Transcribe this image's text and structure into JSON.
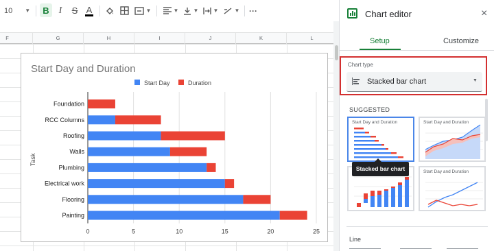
{
  "toolbar": {
    "font_size": "10",
    "bold": "B",
    "italic": "I",
    "strike": "S",
    "text_color": "A",
    "more": "···",
    "accent_green": "#188038",
    "icons": [
      "paint-fill-icon",
      "borders-icon",
      "merge-cells-icon",
      "align-horizontal-icon",
      "align-vertical-icon",
      "text-wrap-icon",
      "text-rotation-icon",
      "more-icon"
    ]
  },
  "sheet": {
    "columns": [
      "F",
      "G",
      "H",
      "I",
      "J",
      "K",
      "L"
    ]
  },
  "chart_data": {
    "type": "bar",
    "orientation": "horizontal",
    "stacked": true,
    "title": "Start Day and Duration",
    "ylabel": "Task",
    "xlabel": "",
    "categories": [
      "Foundation",
      "RCC Columns",
      "Roofing",
      "Walls",
      "Plumbing",
      "Electrical work",
      "Flooring",
      "Painting"
    ],
    "series": [
      {
        "name": "Start Day",
        "color": "#4285f4",
        "values": [
          0,
          3,
          8,
          9,
          13,
          15,
          17,
          21
        ]
      },
      {
        "name": "Duration",
        "color": "#ea4335",
        "values": [
          3,
          5,
          7,
          4,
          1,
          1,
          3,
          3
        ]
      }
    ],
    "xlim": [
      0,
      25
    ],
    "xticks": [
      "0",
      "5",
      "10",
      "15",
      "20",
      "25"
    ],
    "grid": true,
    "legend_position": "top"
  },
  "editor": {
    "title": "Chart editor",
    "close_icon": "×",
    "tabs": [
      {
        "label": "Setup",
        "active": true
      },
      {
        "label": "Customize",
        "active": false
      }
    ],
    "chart_type_label": "Chart type",
    "chart_type_value": "Stacked bar chart",
    "caret": "▼",
    "suggested_label": "SUGGESTED",
    "suggestions": [
      {
        "title": "Start Day and Duration",
        "kind": "stacked-bar",
        "selected": true
      },
      {
        "title": "Start Day and Duration",
        "kind": "area",
        "selected": false
      },
      {
        "title": "",
        "kind": "stacked-column",
        "selected": false
      },
      {
        "title": "Start Day and Duration",
        "kind": "line",
        "selected": false
      }
    ],
    "tooltip": "Stacked bar chart",
    "line_section_label": "Line"
  }
}
